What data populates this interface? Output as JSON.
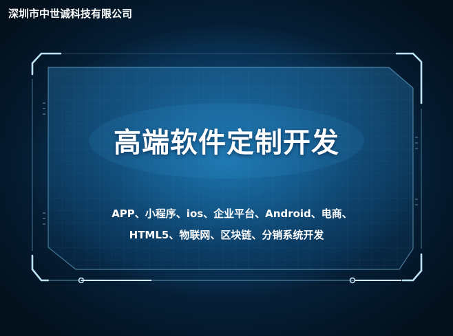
{
  "header": {
    "company_name": "深圳市中世诚科技有限公司"
  },
  "main": {
    "headline": "高端软件定制开发",
    "services_line1": "APP、小程序、ios、企业平台、Android、电商、",
    "services_line2": "HTML5、物联网、区块链、分销系统开发"
  },
  "colors": {
    "background_center": "#1d79b3",
    "background_edge": "#06223c",
    "frame_line": "#9fd2f0",
    "text": "#ffffff"
  }
}
